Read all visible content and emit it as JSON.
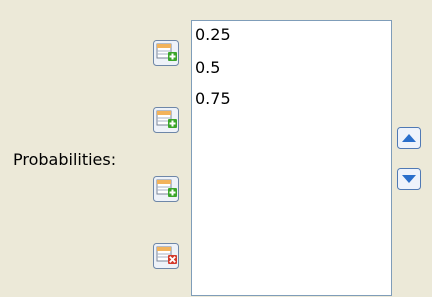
{
  "label": "Probabilities:",
  "values": [
    "0.25",
    "0.5",
    "0.75"
  ],
  "row_buttons": [
    {
      "icon": "add-row-icon"
    },
    {
      "icon": "add-row-icon"
    },
    {
      "icon": "add-row-icon"
    },
    {
      "icon": "delete-row-icon"
    }
  ],
  "move_buttons": {
    "up_icon": "move-up-icon",
    "down_icon": "move-down-icon"
  },
  "colors": {
    "background": "#ece9d8",
    "list_border": "#7f9db9",
    "add_green": "#3aa62a",
    "delete_red": "#d33a2c",
    "arrow_blue": "#2a6fcb"
  }
}
